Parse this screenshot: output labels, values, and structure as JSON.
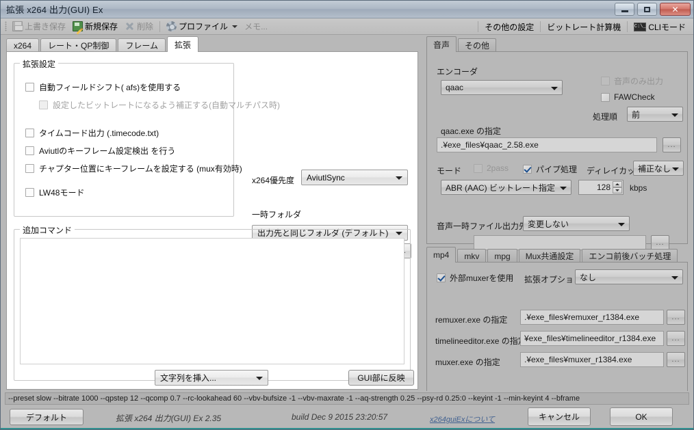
{
  "window": {
    "title": "拡張 x264 出力(GUI) Ex",
    "minimize": "minimize-icon",
    "maximize": "maximize-icon",
    "close": "✕"
  },
  "toolbar": {
    "save_label": "上書き保存",
    "save_as_label": "新規保存",
    "delete_label": "削除",
    "profile_label": "プロファイル",
    "memo_label": "メモ...",
    "other_settings_label": "その他の設定",
    "bitrate_calc_label": "ビットレート計算機",
    "cli_mode_label": "CLIモード",
    "cli_icon_text": "C:\\_"
  },
  "main_tabs": [
    {
      "label": "x264",
      "active": false
    },
    {
      "label": "レート・QP制御",
      "active": false
    },
    {
      "label": "フレーム",
      "active": false
    },
    {
      "label": "拡張",
      "active": true
    }
  ],
  "ext_settings": {
    "group_title": "拡張設定",
    "checkboxes": [
      {
        "label": "自動フィールドシフト( afs)を使用する",
        "checked": false,
        "disabled": false,
        "indent": 0
      },
      {
        "label": "設定したビットレートになるよう補正する(自動マルチパス時)",
        "checked": false,
        "disabled": true,
        "indent": 1
      },
      {
        "label": "タイムコード出力 (.timecode.txt)",
        "checked": false,
        "disabled": false,
        "indent": 0
      },
      {
        "label": "Aviutlのキーフレーム設定検出 を行う",
        "checked": false,
        "disabled": false,
        "indent": 0
      },
      {
        "label": "チャプター位置にキーフレームを設定する (mux有効時)",
        "checked": false,
        "disabled": false,
        "indent": 0
      },
      {
        "label": "LW48モード",
        "checked": false,
        "disabled": false,
        "indent": 0
      }
    ],
    "priority_label": "x264優先度",
    "priority_value": "AviutlSync",
    "temp_folder_label": "一時フォルダ",
    "temp_folder_value": "出力先と同じフォルダ (デフォルト)",
    "temp_folder_path": "",
    "browse_label": "..."
  },
  "additional_command": {
    "group_title": "追加コマンド",
    "text_value": "",
    "insert_string_label": "文字列を挿入...",
    "apply_gui_label": "GUI部に反映"
  },
  "audio": {
    "tabs": [
      {
        "label": "音声",
        "active": true
      },
      {
        "label": "その他",
        "active": false
      }
    ],
    "encoder_label": "エンコーダ",
    "encoder_value": "qaac",
    "audio_only_label": "音声のみ出力",
    "audio_only_checked": false,
    "faw_check_label": "FAWCheck",
    "faw_check_checked": false,
    "order_label": "処理順",
    "order_value": "前",
    "exe_path_label": "qaac.exe の指定",
    "exe_path_value": ".¥exe_files¥qaac_2.58.exe",
    "browse_label": "...",
    "mode_label": "モード",
    "twopass_label": "2pass",
    "twopass_checked": false,
    "pipe_label": "パイプ処理",
    "pipe_checked": true,
    "delaycut_label": "ディレイカット",
    "delaycut_value": "補正なし",
    "bitrate_mode_value": "ABR (AAC) ビットレート指定",
    "bitrate_value": "128",
    "bitrate_unit": "kbps",
    "temp_out_label": "音声一時ファイル出力先",
    "temp_out_value": "変更しない",
    "temp_out_path": ""
  },
  "muxer": {
    "tabs": [
      {
        "label": "mp4",
        "active": true
      },
      {
        "label": "mkv",
        "active": false
      },
      {
        "label": "mpg",
        "active": false
      },
      {
        "label": "Mux共通設定",
        "active": false
      },
      {
        "label": "エンコ前後バッチ処理",
        "active": false
      }
    ],
    "use_external_label": "外部muxerを使用",
    "use_external_checked": true,
    "ext_option_label": "拡張オプション",
    "ext_option_value": "なし",
    "rows": [
      {
        "label": "remuxer.exe の指定",
        "value": ".¥exe_files¥remuxer_r1384.exe"
      },
      {
        "label": "timelineeditor.exe の指定",
        "value": "¥exe_files¥timelineeditor_r1384.exe"
      },
      {
        "label": "muxer.exe の指定",
        "value": ".¥exe_files¥muxer_r1384.exe"
      }
    ],
    "browse_label": "..."
  },
  "bottom": {
    "command_line": "--preset slow --bitrate 1000 --qpstep 12 --qcomp 0.7 --rc-lookahead 60 --vbv-bufsize -1 --vbv-maxrate -1 --aq-strength 0.25 --psy-rd 0.25:0 --keyint -1 --min-keyint 4 --bframe",
    "default_label": "デフォルト",
    "version_text": "拡張 x264 出力(GUI) Ex 2.35",
    "build_text": "build Dec  9 2015 23:20:57",
    "about_link": "x264guiExについて",
    "cancel_label": "キャンセル",
    "ok_label": "OK"
  },
  "colors": {
    "accent_teal": "#2f8f8f",
    "window_bg": "#b8b8b8",
    "panel_white": "#ffffff",
    "link": "#3f5f8f"
  }
}
